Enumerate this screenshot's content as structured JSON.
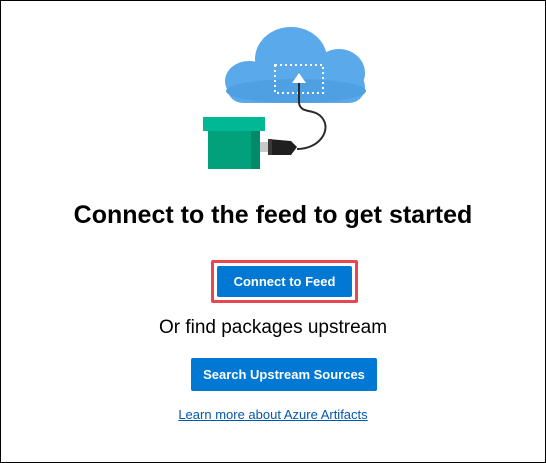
{
  "empty_state": {
    "heading": "Connect to the feed to get started",
    "connect_button_label": "Connect to Feed",
    "subheading": "Or find packages upstream",
    "search_button_label": "Search Upstream Sources",
    "learn_more_link": "Learn more about Azure Artifacts"
  },
  "illustration": {
    "icons": [
      "cloud-icon",
      "package-box-icon",
      "plug-icon",
      "upload-arrow-icon"
    ]
  },
  "colors": {
    "primary_button": "#0078d4",
    "highlight_border": "#e8474f",
    "link": "#0058ad",
    "cloud": "#5aa9ea",
    "box": "#00a17b"
  }
}
